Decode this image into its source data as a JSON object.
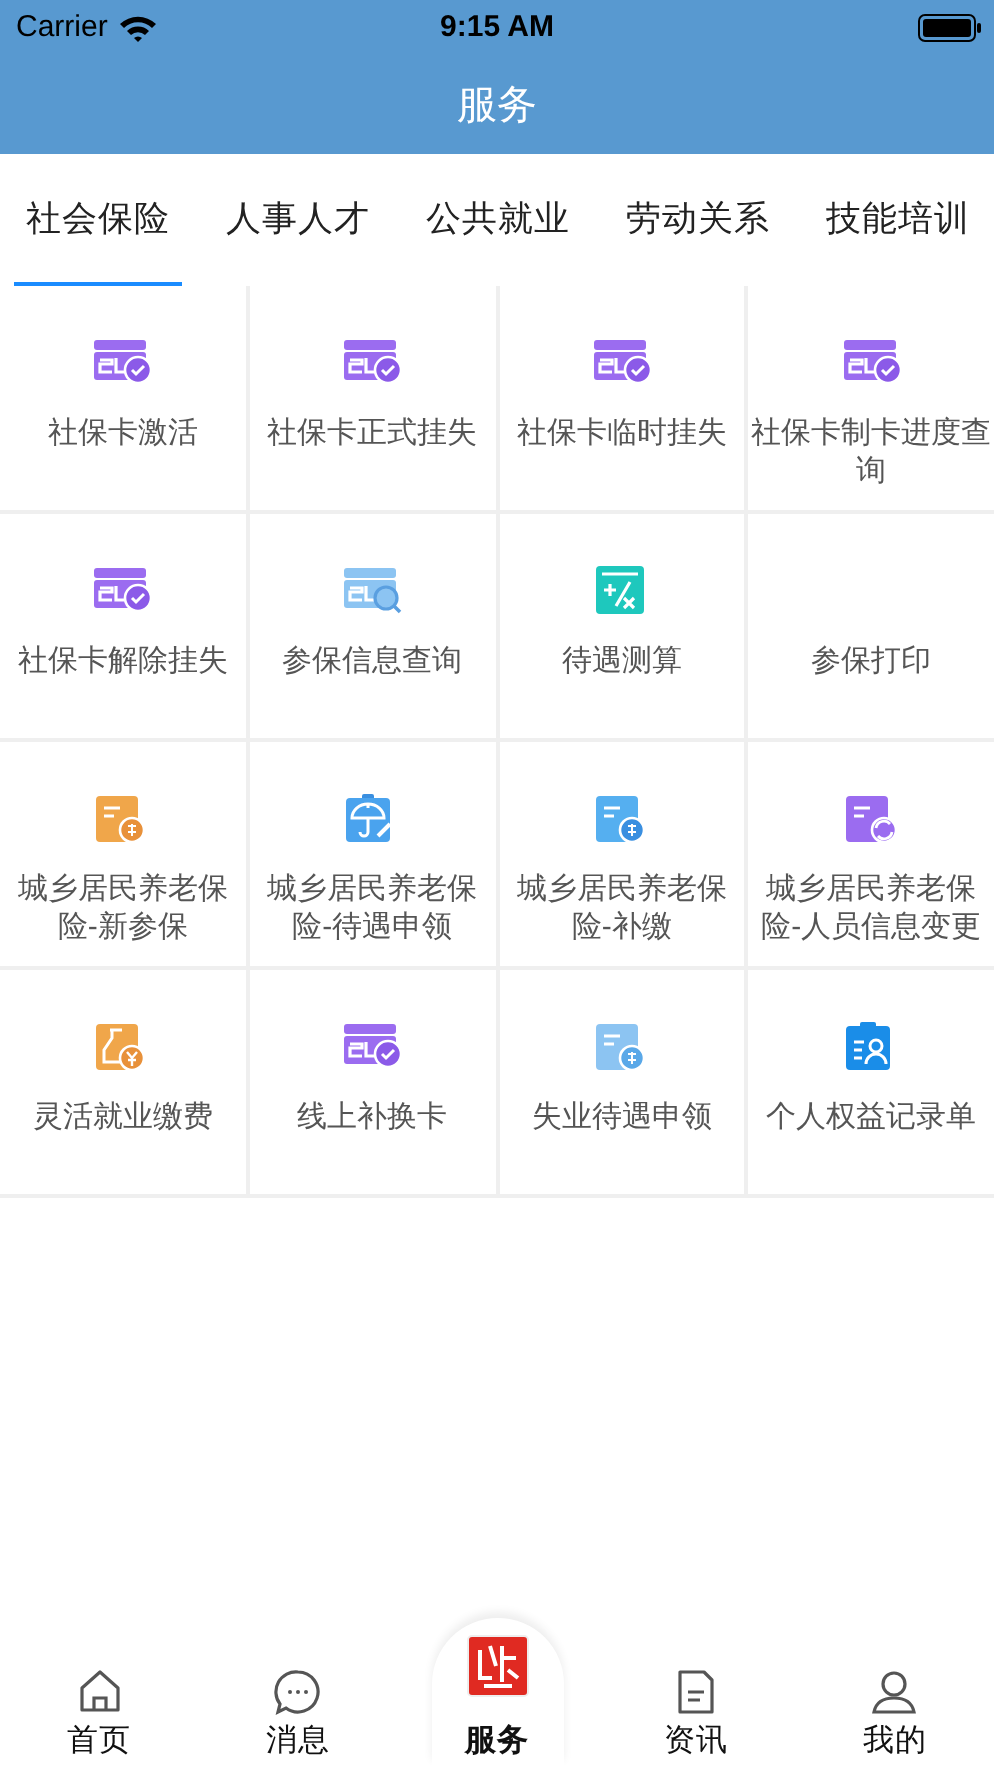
{
  "status_bar": {
    "carrier": "Carrier",
    "time": "9:15 AM"
  },
  "nav_bar": {
    "title": "服务"
  },
  "tabs": [
    {
      "label": "社会保险",
      "selected": true
    },
    {
      "label": "人事人才",
      "selected": false
    },
    {
      "label": "公共就业",
      "selected": false
    },
    {
      "label": "劳动关系",
      "selected": false
    },
    {
      "label": "技能培训",
      "selected": false
    }
  ],
  "services": [
    {
      "label": "社保卡激活",
      "kind": "card"
    },
    {
      "label": "社保卡正式挂失",
      "kind": "card"
    },
    {
      "label": "社保卡临时挂失",
      "kind": "card"
    },
    {
      "label": "社保卡制卡进度查询",
      "kind": "card"
    },
    {
      "label": "社保卡解除挂失",
      "kind": "card"
    },
    {
      "label": "参保信息查询",
      "kind": "query"
    },
    {
      "label": "待遇测算",
      "kind": "calculator"
    },
    {
      "label": "参保打印",
      "kind": "plain"
    },
    {
      "label": "城乡居民养老保险-新参保",
      "kind": "enroll"
    },
    {
      "label": "城乡居民养老保险-待遇申领",
      "kind": "claim"
    },
    {
      "label": "城乡居民养老保险-补缴",
      "kind": "backpay"
    },
    {
      "label": "城乡居民养老保险-人员信息变更",
      "kind": "change"
    },
    {
      "label": "灵活就业缴费",
      "kind": "payment"
    },
    {
      "label": "线上补换卡",
      "kind": "card"
    },
    {
      "label": "失业待遇申领",
      "kind": "benefit"
    },
    {
      "label": "个人权益记录单",
      "kind": "record"
    }
  ],
  "bottom_tabs": [
    {
      "label": "首页",
      "kind": "home",
      "selected": false
    },
    {
      "label": "消息",
      "kind": "chat",
      "selected": false
    },
    {
      "label": "服务",
      "kind": "logo",
      "selected": true
    },
    {
      "label": "资讯",
      "kind": "doc",
      "selected": false
    },
    {
      "label": "我的",
      "kind": "person",
      "selected": false
    }
  ]
}
